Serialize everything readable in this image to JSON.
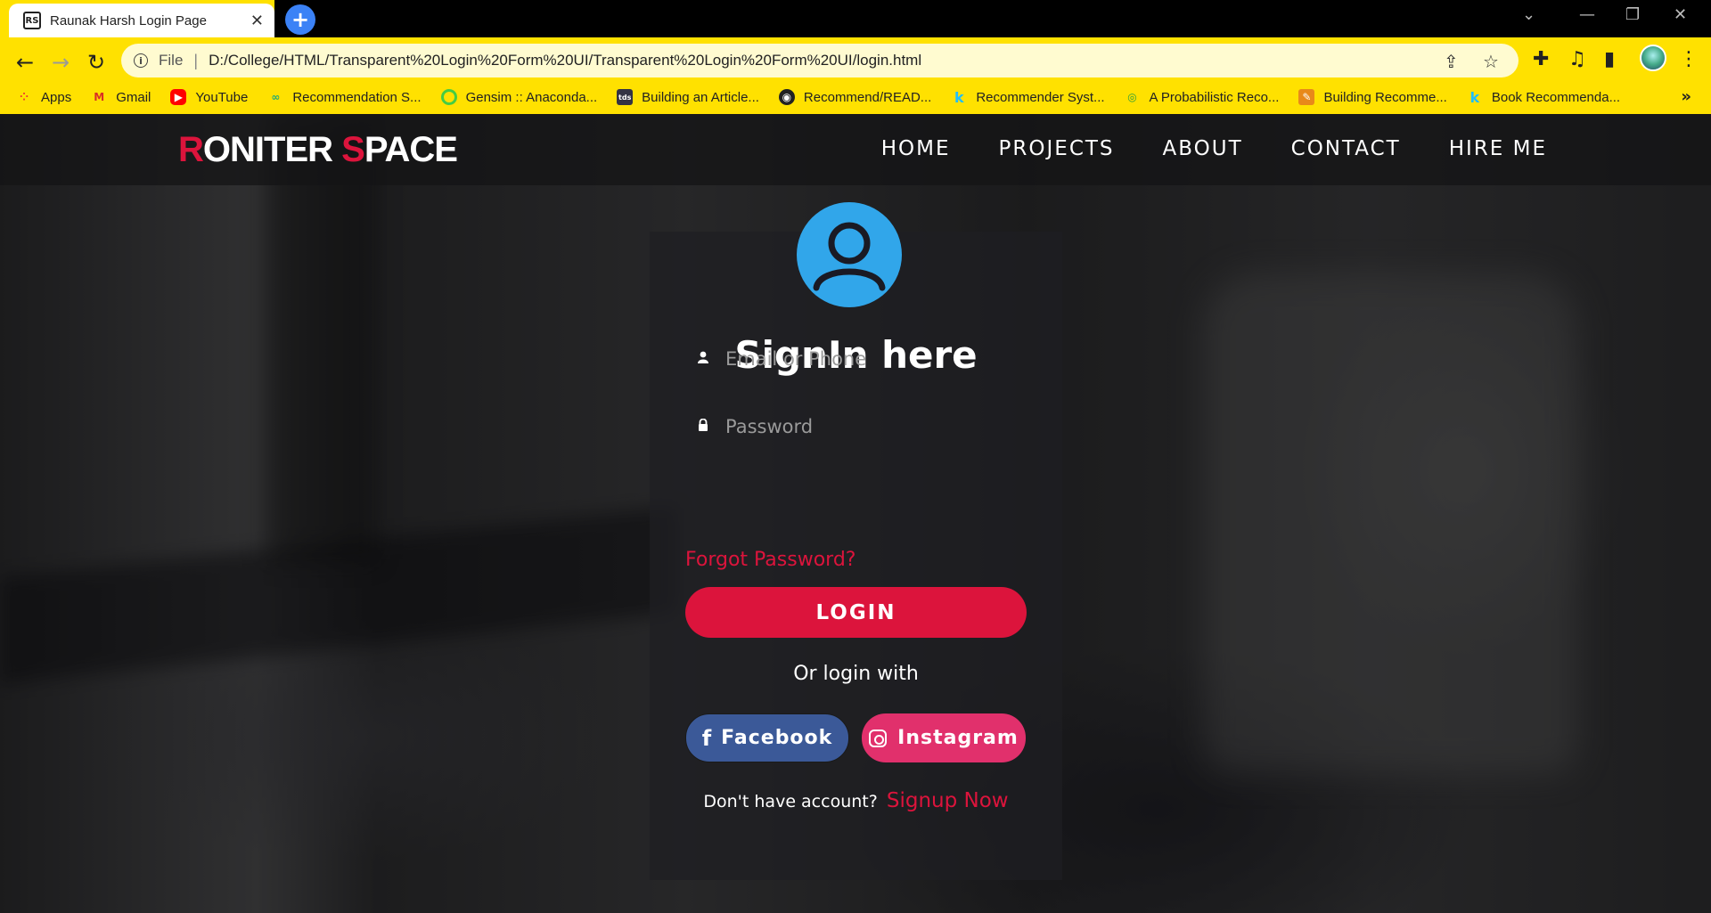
{
  "browser": {
    "tab_title": "Raunak Harsh Login Page",
    "favicon_text": "RS",
    "close_glyph": "✕",
    "new_tab_glyph": "+",
    "file_label": "File",
    "url": "D:/College/HTML/Transparent%20Login%20Form%20UI/Transparent%20Login%20Form%20UI/login.html",
    "bookmarks": [
      {
        "label": "Apps",
        "icon": "apps-grid-icon"
      },
      {
        "label": "Gmail",
        "icon": "gmail-icon"
      },
      {
        "label": "YouTube",
        "icon": "youtube-icon"
      },
      {
        "label": "Recommendation S...",
        "icon": "link-icon"
      },
      {
        "label": "Gensim :: Anaconda...",
        "icon": "gensim-icon"
      },
      {
        "label": "Building an Article...",
        "icon": "tds-icon"
      },
      {
        "label": "Recommend/READ...",
        "icon": "github-icon"
      },
      {
        "label": "Recommender Syst...",
        "icon": "kaggle-icon"
      },
      {
        "label": "A Probabilistic Reco...",
        "icon": "eye-icon"
      },
      {
        "label": "Building Recomme...",
        "icon": "book-icon"
      },
      {
        "label": "Book Recommenda...",
        "icon": "kaggle-icon"
      }
    ],
    "colors": {
      "chrome": "#ffe100"
    }
  },
  "site": {
    "logo_first_letter": "R",
    "logo_part1": "ONITER ",
    "logo_second_letter": "S",
    "logo_part2": "PACE",
    "nav": [
      "HOME",
      "PROJECTS",
      "ABOUT",
      "CONTACT",
      "HIRE ME"
    ]
  },
  "login": {
    "heading": "SignIn here",
    "email_placeholder": "Email or Phone",
    "password_placeholder": "Password",
    "forgot": "Forgot Password?",
    "login_button": "LOGIN",
    "or_text": "Or login with",
    "facebook": "Facebook",
    "instagram": "Instagram",
    "no_account": "Don't have account?",
    "signup": "Signup Now",
    "accent_color": "#dc143c",
    "avatar_color": "#31a6ea"
  }
}
